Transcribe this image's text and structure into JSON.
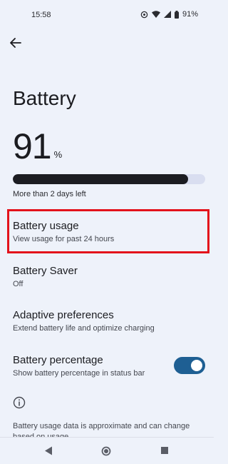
{
  "status_bar": {
    "time": "15:58",
    "battery_percent": "91%"
  },
  "header": {
    "title": "Battery"
  },
  "battery": {
    "level": "91",
    "unit": "%",
    "fill_fraction": 0.91,
    "time_left": "More than 2 days left"
  },
  "items": {
    "usage": {
      "title": "Battery usage",
      "subtitle": "View usage for past 24 hours"
    },
    "saver": {
      "title": "Battery Saver",
      "subtitle": "Off"
    },
    "adaptive": {
      "title": "Adaptive preferences",
      "subtitle": "Extend battery life and optimize charging"
    },
    "percentage": {
      "title": "Battery percentage",
      "subtitle": "Show battery percentage in status bar",
      "enabled": true
    }
  },
  "footer": {
    "text": "Battery usage data is approximate and can change based on usage."
  },
  "colors": {
    "background": "#eef2fa",
    "highlight": "#e3121b",
    "toggle_on": "#1e5f93",
    "bar_fill": "#1c1d22"
  }
}
